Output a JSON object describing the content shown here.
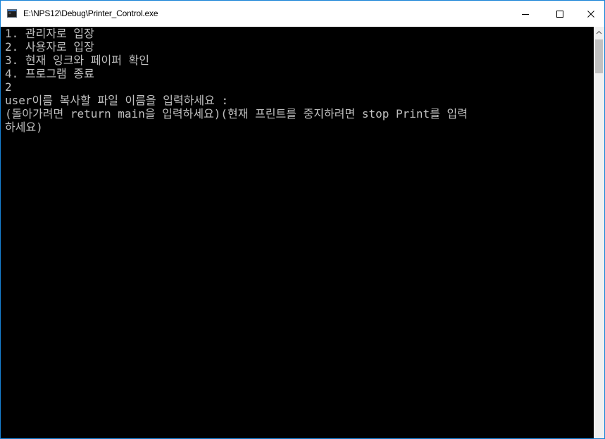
{
  "window": {
    "title": "E:\\NPS12\\Debug\\Printer_Control.exe",
    "icon": "console-app-icon",
    "controls": {
      "minimize": "minimize-icon",
      "maximize": "maximize-icon",
      "close": "close-icon"
    },
    "border_color": "#1883d7"
  },
  "console": {
    "background": "#000000",
    "foreground": "#c0c0c0",
    "lines": [
      "1. 관리자로 입장",
      "2. 사용자로 입장",
      "3. 현재 잉크와 페이퍼 확인",
      "4. 프로그램 종료",
      "2",
      "user이름 복사할 파일 이름을 입력하세요 :",
      "(돌아가려면 return main을 입력하세요)(현재 프린트를 중지하려면 stop Print를 입력",
      "하세요)"
    ]
  },
  "scrollbar": {
    "up_icon": "scroll-up-arrow-icon"
  }
}
